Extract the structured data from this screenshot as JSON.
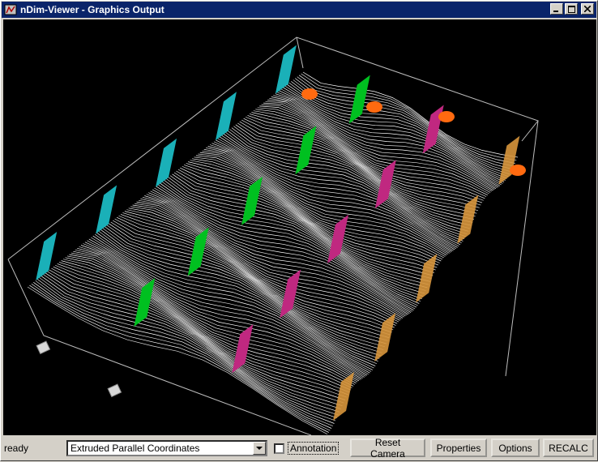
{
  "window": {
    "title": "nDim-Viewer - Graphics Output"
  },
  "viewport": {
    "scene": "extruded-parallel-coordinates-3d",
    "background": "#000000",
    "series_colors": [
      "#1ab0b8",
      "#00c020",
      "#c02880",
      "#d8963c"
    ],
    "marker_color": "#ff6a10"
  },
  "statusbar": {
    "status": "ready",
    "mode_select": {
      "value": "Extruded Parallel Coordinates"
    },
    "annotation_label": "Annotation",
    "annotation_checked": false,
    "buttons": {
      "reset_camera": "Reset Camera",
      "properties": "Properties",
      "options": "Options",
      "recalc": "RECALC"
    }
  },
  "icons": {
    "app": "app-icon",
    "minimize": "minimize-icon",
    "maximize": "maximize-icon",
    "close": "close-icon",
    "dropdown": "chevron-down-icon"
  }
}
